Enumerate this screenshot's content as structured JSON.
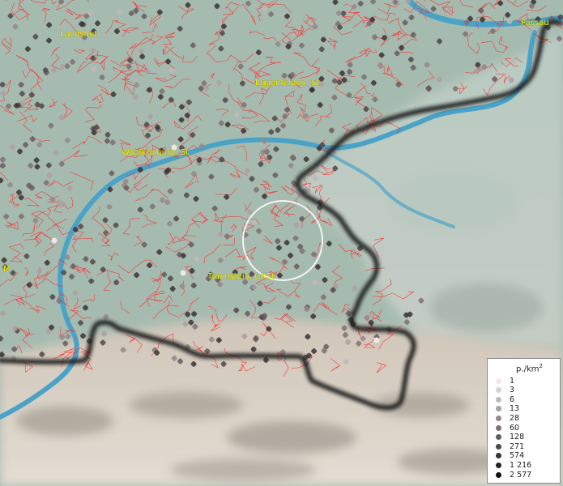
{
  "map": {
    "labels": [
      {
        "id": "landshut",
        "text": "Landshut"
      },
      {
        "id": "passau",
        "text": "Passau"
      },
      {
        "id": "eggenfelden",
        "text": "Eggenfelden, St"
      },
      {
        "id": "waldkraiburg",
        "text": "Waldkraiburg, St"
      },
      {
        "id": "traunstein",
        "text": "Traunstein, GKSt"
      },
      {
        "id": "m-edge",
        "text": "M"
      }
    ],
    "colors": {
      "border": "#1a1a1a",
      "municipality_lines": "#ff2a2a",
      "rivers": "#4aa3c7",
      "label_text": "#f0f000",
      "terrain_lowland": "#a9bdb2",
      "terrain_alps": "#d8cfc4",
      "highlight_circle": "#ffffff"
    }
  },
  "legend": {
    "title": "p./km",
    "title_sup": "2",
    "items": [
      {
        "label": "1",
        "color": "#f1e6e6"
      },
      {
        "label": "3",
        "color": "#dccfd0"
      },
      {
        "label": "6",
        "color": "#c6b6b8"
      },
      {
        "label": "13",
        "color": "#af9ea1"
      },
      {
        "label": "28",
        "color": "#97878a"
      },
      {
        "label": "60",
        "color": "#7f7073"
      },
      {
        "label": "128",
        "color": "#685b5e"
      },
      {
        "label": "271",
        "color": "#51464a"
      },
      {
        "label": "574",
        "color": "#3b3235"
      },
      {
        "label": "1 216",
        "color": "#262022"
      },
      {
        "label": "2 577",
        "color": "#111011"
      }
    ]
  }
}
